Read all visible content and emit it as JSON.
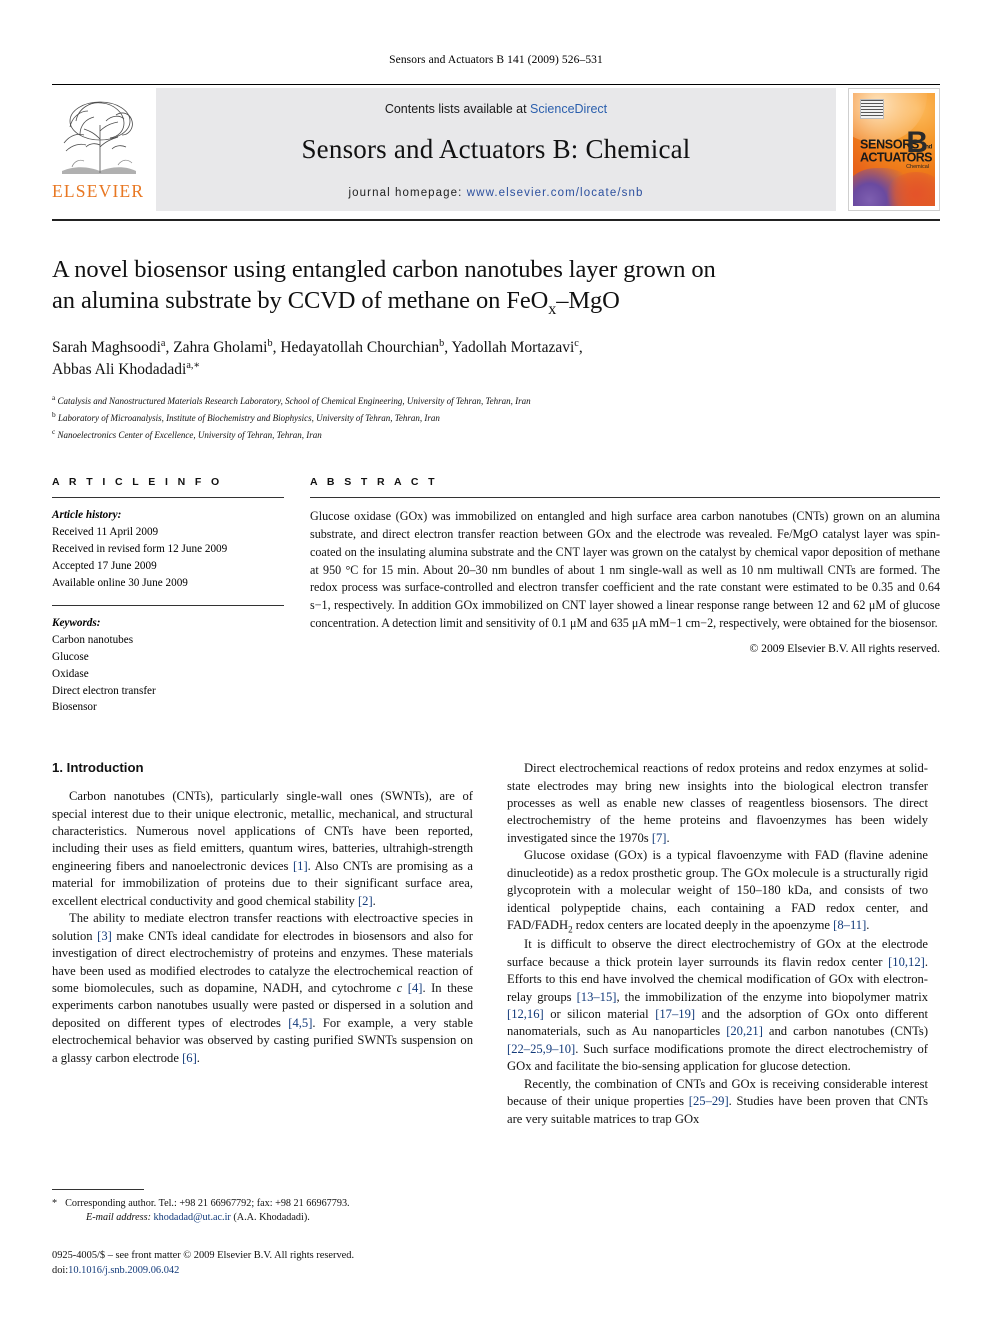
{
  "running_head": "Sensors and Actuators B 141 (2009) 526–531",
  "masthead": {
    "contents_prefix": "Contents lists available at ",
    "sciencedirect": "ScienceDirect",
    "journal_title": "Sensors and Actuators B: Chemical",
    "homepage_label": "journal homepage:",
    "homepage_url": "www.elsevier.com/locate/snb",
    "elsevier_wordmark": "ELSEVIER",
    "cover": {
      "line1": "SENSORS",
      "and": "and",
      "line2": "ACTUATORS",
      "letter": "B",
      "sub": "Chemical"
    },
    "accent_orange": "#E87722",
    "link_blue": "#2b5fad",
    "band_gray": "#e8e8ea"
  },
  "title": {
    "line1": "A novel biosensor using entangled carbon nanotubes layer grown on",
    "line2_a": "an alumina substrate by CCVD of methane on FeO",
    "line2_sub": "x",
    "line2_b": "–MgO"
  },
  "authors": {
    "line1": "Sarah Maghsoodi a, Zahra Gholami b, Hedayatollah Chourchian b, Yadollah Mortazavi c,",
    "line2": "Abbas Ali Khodadadi a,*"
  },
  "affiliations": [
    "a Catalysis and Nanostructured Materials Research Laboratory, School of Chemical Engineering, University of Tehran, Tehran, Iran",
    "b Laboratory of Microanalysis, Institute of Biochemistry and Biophysics, University of Tehran, Tehran, Iran",
    "c Nanoelectronics Center of Excellence, University of Tehran, Tehran, Iran"
  ],
  "article_info": {
    "heading": "A R T I C L E    I N F O",
    "history_label": "Article history:",
    "history": [
      "Received 11 April 2009",
      "Received in revised form 12 June 2009",
      "Accepted 17 June 2009",
      "Available online 30 June 2009"
    ],
    "keywords_label": "Keywords:",
    "keywords": [
      "Carbon nanotubes",
      "Glucose",
      "Oxidase",
      "Direct electron transfer",
      "Biosensor"
    ]
  },
  "abstract": {
    "heading": "A B S T R A C T",
    "text": "Glucose oxidase (GOx) was immobilized on entangled and high surface area carbon nanotubes (CNTs) grown on an alumina substrate, and direct electron transfer reaction between GOx and the electrode was revealed. Fe/MgO catalyst layer was spin-coated on the insulating alumina substrate and the CNT layer was grown on the catalyst by chemical vapor deposition of methane at 950 °C for 15 min. About 20–30 nm bundles of about 1 nm single-wall as well as 10 nm multiwall CNTs are formed. The redox process was surface-controlled and electron transfer coefficient and the rate constant were estimated to be 0.35 and 0.64 s−1, respectively. In addition GOx immobilized on CNT layer showed a linear response range between 12 and 62 μM of glucose concentration. A detection limit and sensitivity of 0.1 μM and 635 μA mM−1 cm−2, respectively, were obtained for the biosensor.",
    "copyright": "© 2009 Elsevier B.V. All rights reserved."
  },
  "body": {
    "section_title": "1.  Introduction",
    "left_paragraphs": [
      "Carbon nanotubes (CNTs), particularly single-wall ones (SWNTs), are of special interest due to their unique electronic, metallic, mechanical, and structural characteristics. Numerous novel applications of CNTs have been reported, including their uses as field emitters, quantum wires, batteries, ultrahigh-strength engineering fibers and nanoelectronic devices [1]. Also CNTs are promising as a material for immobilization of proteins due to their significant surface area, excellent electrical conductivity and good chemical stability [2].",
      "The ability to mediate electron transfer reactions with electroactive species in solution [3] make CNTs ideal candidate for electrodes in biosensors and also for investigation of direct electrochemistry of proteins and enzymes. These materials have been used as modified electrodes to catalyze the electrochemical reaction of some biomolecules, such as dopamine, NADH, and cytochrome c [4]. In these experiments carbon nanotubes usually were pasted or dispersed in a solution and deposited on different types of electrodes [4,5]. For example, a very stable electrochemical behavior was observed by casting purified SWNTs suspension on a glassy carbon electrode [6]."
    ],
    "right_paragraphs": [
      "Direct electrochemical reactions of redox proteins and redox enzymes at solid-state electrodes may bring new insights into the biological electron transfer processes as well as enable new classes of reagentless biosensors. The direct electrochemistry of the heme proteins and flavoenzymes has been widely investigated since the 1970s [7].",
      "Glucose oxidase (GOx) is a typical flavoenzyme with FAD (flavine adenine dinucleotide) as a redox prosthetic group. The GOx molecule is a structurally rigid glycoprotein with a molecular weight of 150–180 kDa, and consists of two identical polypeptide chains, each containing a FAD redox center, and FAD/FADH2 redox centers are located deeply in the apoenzyme [8–11].",
      "It is difficult to observe the direct electrochemistry of GOx at the electrode surface because a thick protein layer surrounds its flavin redox center [10,12]. Efforts to this end have involved the chemical modification of GOx with electron-relay groups [13–15], the immobilization of the enzyme into biopolymer matrix [12,16] or silicon material [17–19] and the adsorption of GOx onto different nanomaterials, such as Au nanoparticles [20,21] and carbon nanotubes (CNTs) [22–25,9–10]. Such surface modifications promote the direct electrochemistry of GOx and facilitate the bio-sensing application for glucose detection.",
      "Recently, the combination of CNTs and GOx is receiving considerable interest because of their unique properties [25–29]. Studies have been proven that CNTs are very suitable matrices to trap GOx"
    ]
  },
  "footnote": {
    "star": "*",
    "corresponding": "Corresponding author. Tel.: +98 21 66967792; fax: +98 21 66967793.",
    "email_label": "E-mail address:",
    "email": "khodadad@ut.ac.ir",
    "email_suffix": "(A.A. Khodadadi).",
    "issn_line": "0925-4005/$ – see front matter © 2009 Elsevier B.V. All rights reserved.",
    "doi_label": "doi:",
    "doi": "10.1016/j.snb.2009.06.042"
  }
}
